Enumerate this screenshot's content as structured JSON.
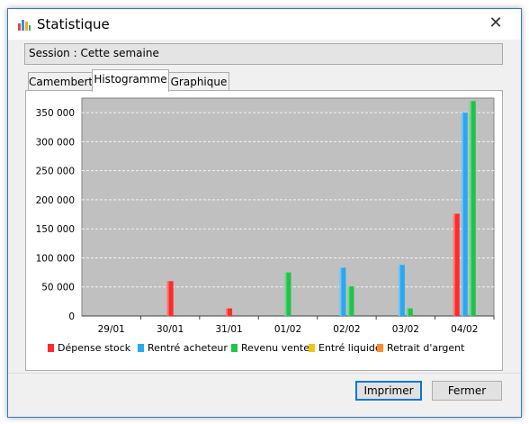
{
  "window": {
    "title": "Statistique",
    "close_glyph": "✕"
  },
  "session": {
    "label": "Session : Cette semaine"
  },
  "tabs": [
    {
      "label": "Camembert",
      "active": false
    },
    {
      "label": "Histogramme",
      "active": true
    },
    {
      "label": "Graphique",
      "active": false
    }
  ],
  "buttons": {
    "print": "Imprimer",
    "close": "Fermer"
  },
  "icons": {
    "app": "bar-chart-icon",
    "close": "close-icon"
  },
  "chart_data": {
    "type": "bar",
    "categories": [
      "29/01",
      "30/01",
      "31/01",
      "01/02",
      "02/02",
      "03/02",
      "04/02"
    ],
    "ylim": [
      0,
      375000
    ],
    "yticks": [
      0,
      50000,
      100000,
      150000,
      200000,
      250000,
      300000,
      350000
    ],
    "ytick_labels": [
      "0",
      "50 000",
      "100 000",
      "150 000",
      "200 000",
      "250 000",
      "300 000",
      "350 000"
    ],
    "grid": true,
    "legend_position": "bottom",
    "series": [
      {
        "name": "Dépense stock",
        "color": "#ff2b2b",
        "values": [
          0,
          60000,
          13000,
          0,
          0,
          0,
          176000
        ]
      },
      {
        "name": "Rentré acheteur",
        "color": "#2aa7f0",
        "values": [
          0,
          0,
          0,
          0,
          83000,
          88000,
          350000
        ]
      },
      {
        "name": "Revenu vente",
        "color": "#21c24c",
        "values": [
          0,
          0,
          0,
          75000,
          51000,
          13000,
          370000
        ]
      },
      {
        "name": "Entré liquide",
        "color": "#f3c40f",
        "values": [
          0,
          0,
          0,
          0,
          0,
          0,
          0
        ]
      },
      {
        "name": "Retrait d'argent",
        "color": "#ff8a2a",
        "values": [
          0,
          0,
          0,
          0,
          0,
          0,
          0
        ]
      }
    ]
  }
}
